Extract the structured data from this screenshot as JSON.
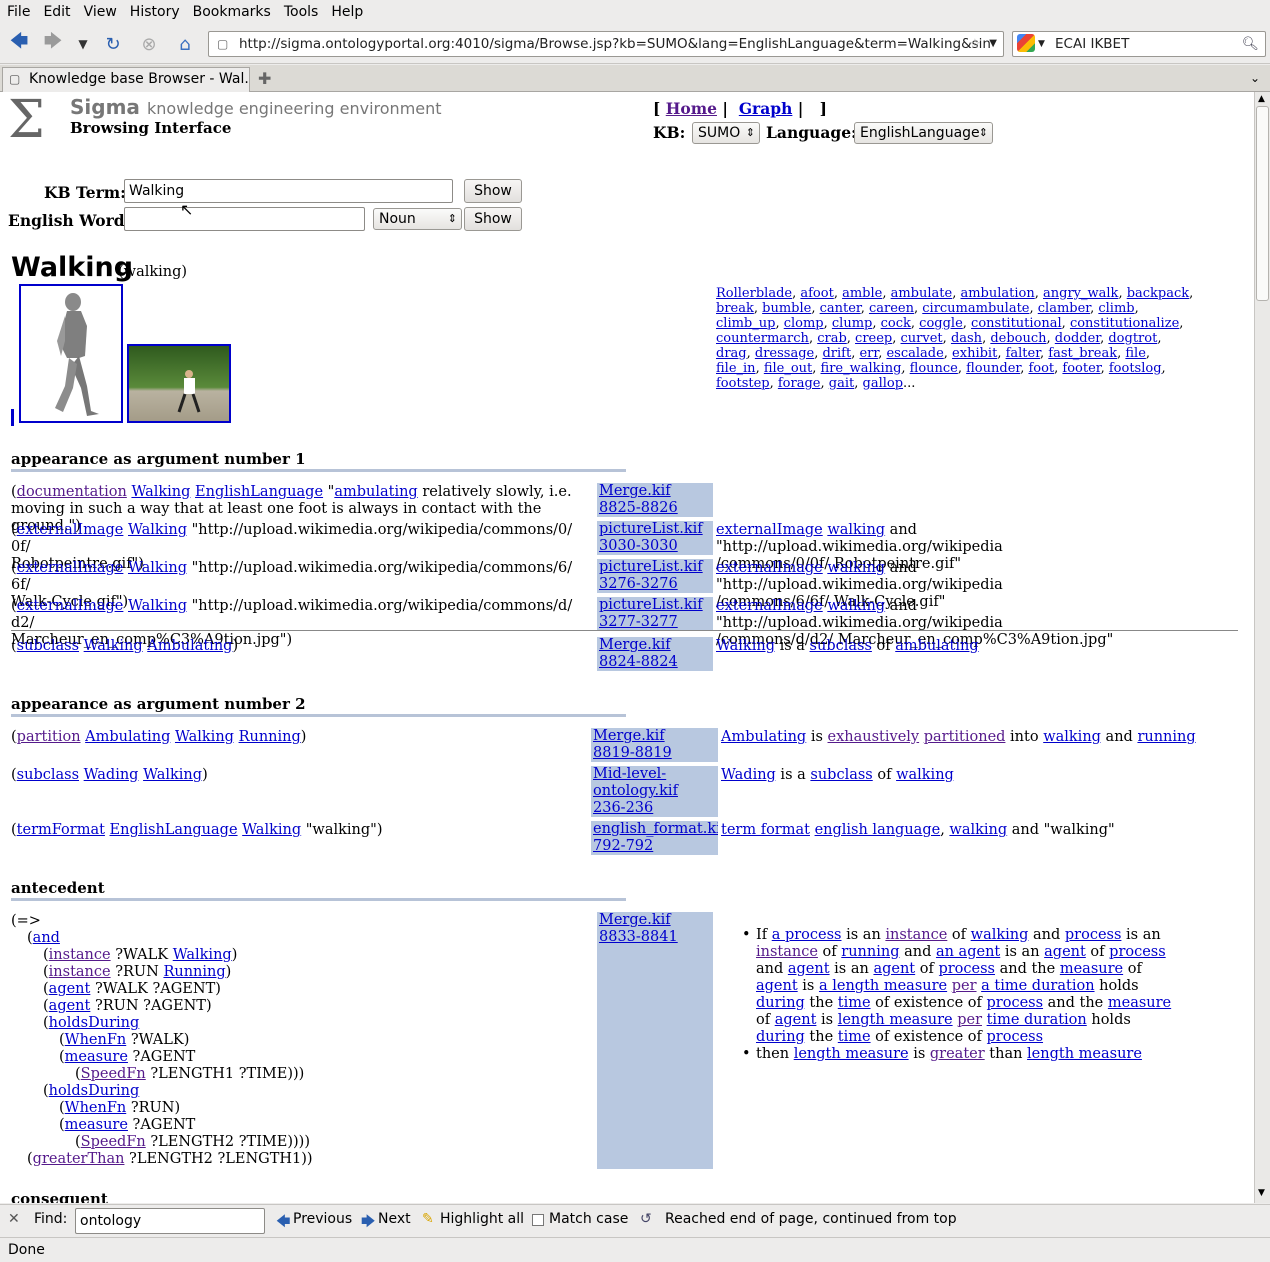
{
  "menu": [
    "File",
    "Edit",
    "View",
    "History",
    "Bookmarks",
    "Tools",
    "Help"
  ],
  "browser": {
    "url": "http://sigma.ontologyportal.org:4010/sigma/Browse.jsp?kb=SUMO&lang=EnglishLanguage&term=Walking&sin",
    "search_value": "ECAI IKBET",
    "tab_title": "Knowledge base Browser - Wal..."
  },
  "header": {
    "title": "Sigma",
    "subtitle": "knowledge engineering environment",
    "interface": "Browsing Interface",
    "nav_home": "Home",
    "nav_graph": "Graph",
    "kb_label": "KB:",
    "kb_value": "SUMO",
    "lang_label": "Language:",
    "lang_value": "EnglishLanguage"
  },
  "form": {
    "kb_term_label": "KB Term:",
    "kb_term_value": "Walking",
    "show1": "Show",
    "word_label": "English Word:",
    "word_value": "",
    "pos_value": "Noun",
    "show2": "Show"
  },
  "term": {
    "name": "Walking",
    "lex": "(walking)"
  },
  "words": [
    "Rollerblade",
    "afoot",
    "amble",
    "ambulate",
    "ambulation",
    "angry_walk",
    "backpack",
    "break",
    "bumble",
    "canter",
    "careen",
    "circumambulate",
    "clamber",
    "climb",
    "climb_up",
    "clomp",
    "clump",
    "cock",
    "coggle",
    "constitutional",
    "constitutionalize",
    "countermarch",
    "crab",
    "creep",
    "curvet",
    "dash",
    "debouch",
    "dodder",
    "dogtrot",
    "drag",
    "dressage",
    "drift",
    "err",
    "escalade",
    "exhibit",
    "falter",
    "fast_break",
    "file",
    "file_in",
    "file_out",
    "fire_walking",
    "flounce",
    "flounder",
    "foot",
    "footer",
    "footslog",
    "footstep",
    "forage",
    "gait",
    "gallop"
  ],
  "words_more": "...",
  "sections": {
    "arg1": "appearance as argument number 1",
    "arg2": "appearance as argument number 2",
    "antecedent": "antecedent",
    "consequent": "consequent"
  },
  "arg1": {
    "r1": {
      "p1": "(",
      "pred": "documentation",
      "a1": "Walking",
      "a2": "EnglishLanguage",
      "q": "\"",
      "l": "ambulating",
      "t": " relatively slowly, i.e. moving in such a way that at least one foot is always in contact with the ground.\")",
      "src1": "Merge.kif",
      "src2": "8825-8826"
    },
    "r2": {
      "pred": "externalImage",
      "a1": "Walking",
      "t1": "\"http://upload.wikimedia.org/wikipedia/commons/0/ 0f/",
      "t2": "Robotpeintre.gif\")",
      "src1": "pictureList.kif",
      "src2": "3030-3030",
      "e1": "externalImage",
      "e2": "walking",
      "e3": " and \"http://upload.wikimedia.org/wikipedia",
      "e4": "/commons/0/0f/ Robotpeintre.gif\""
    },
    "r3": {
      "pred": "externalImage",
      "a1": "Walking",
      "t1": "\"http://upload.wikimedia.org/wikipedia/commons/6/ 6f/",
      "t2": "Walk-Cycle.gif\")",
      "src1": "pictureList.kif",
      "src2": "3276-3276",
      "e1": "externalImage",
      "e2": "walking",
      "e3": " and \"http://upload.wikimedia.org/wikipedia",
      "e4": "/commons/6/6f/ Walk-Cycle.gif\""
    },
    "r4": {
      "pred": "externalImage",
      "a1": "Walking",
      "t1": "\"http://upload.wikimedia.org/wikipedia/commons/d/ d2/",
      "t2": "Marcheur_en_comp%C3%A9tion.jpg\")",
      "src1": "pictureList.kif",
      "src2": "3277-3277",
      "e1": "externalImage",
      "e2": "walking",
      "e3": " and \"http://upload.wikimedia.org/wikipedia",
      "e4": "/commons/d/d2/ Marcheur_en_comp%C3%A9tion.jpg\""
    },
    "r5": {
      "pred": "subclass",
      "a1": "Walking",
      "a2": "Ambulating",
      "src1": "Merge.kif",
      "src2": "8824-8824",
      "e1": "Walking",
      "e2": " is a ",
      "e3": "subclass",
      "e4": " of ",
      "e5": "ambulating"
    }
  },
  "arg2": {
    "r1": {
      "pred": "partition",
      "a1": "Ambulating",
      "a2": "Walking",
      "a3": "Running",
      "src1": "Merge.kif",
      "src2": "8819-8819",
      "e1": "Ambulating",
      "e2": " is ",
      "e3": "exhaustively",
      "e4": "partitioned",
      "e5": " into ",
      "e6": "walking",
      "e7": " and ",
      "e8": "running"
    },
    "r2": {
      "pred": "subclass",
      "a1": "Wading",
      "a2": "Walking",
      "src1": "Mid-level-",
      "src1b": "ontology.kif",
      "src2": "236-236",
      "e1": "Wading",
      "e2": " is a ",
      "e3": "subclass",
      "e4": " of ",
      "e5": "walking"
    },
    "r3": {
      "pred": "termFormat",
      "a1": "EnglishLanguage",
      "a2": "Walking",
      "t": " \"walking\")",
      "src1": "english_format.kif",
      "src2": "792-792",
      "e1": "term format",
      "e2": "english language",
      "e3": ", ",
      "e4": "walking",
      "e5": " and \"walking\""
    }
  },
  "ante": {
    "src1": "Merge.kif",
    "src2": "8833-8841",
    "l1": "(=>",
    "and": "and",
    "instance": "instance",
    "walkvar": " ?WALK ",
    "Walking": "Walking",
    "runvar": " ?RUN ",
    "Running": "Running",
    "agent": "agent",
    "agent_walk": " ?WALK ?AGENT)",
    "agent_run": " ?RUN ?AGENT)",
    "holdsDuring": "holdsDuring",
    "WhenFn": "WhenFn",
    "whenwalk": " ?WALK)",
    "whenrun": " ?RUN)",
    "measure": "measure",
    "mvar": " ?AGENT",
    "SpeedFn": "SpeedFn",
    "speed1": " ?LENGTH1 ?TIME)))",
    "speed2": " ?LENGTH2 ?TIME))))",
    "greaterThan": "greaterThan",
    "gt": " ?LENGTH2 ?LENGTH1))",
    "nl_if": "If",
    "nl_then": "then"
  },
  "findbar": {
    "label": "Find:",
    "value": "ontology",
    "prev": "Previous",
    "next": "Next",
    "highlight": "Highlight all",
    "match": "Match case",
    "msg": "Reached end of page, continued from top"
  },
  "status": "Done"
}
